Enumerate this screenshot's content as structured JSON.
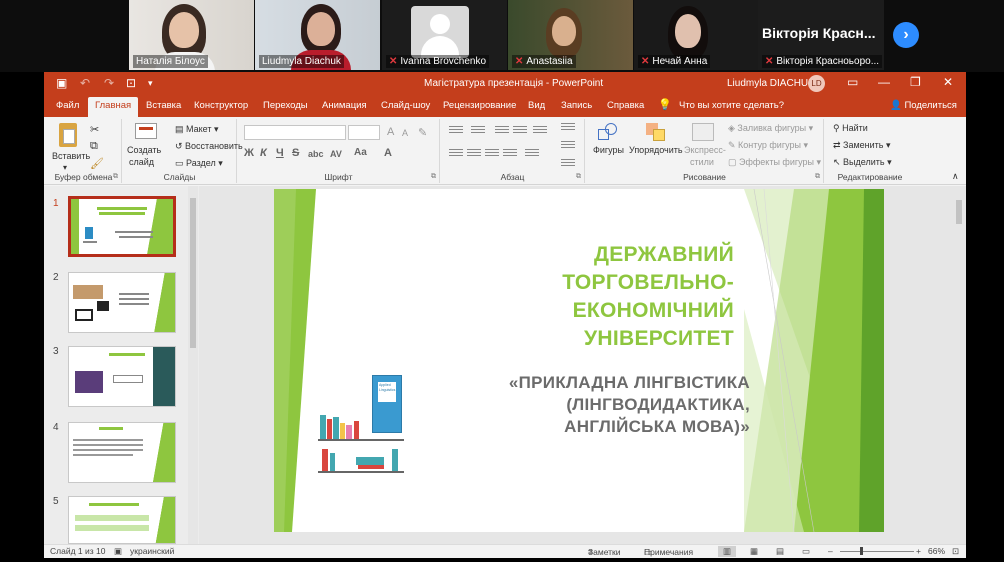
{
  "meeting": {
    "participants": [
      {
        "name": "Наталія Білоус",
        "muted": false,
        "active": false
      },
      {
        "name": "Liudmyla Diachuk",
        "muted": false,
        "active": true
      },
      {
        "name": "Ivanna Brovchenko",
        "muted": true,
        "active": false
      },
      {
        "name": "Anastasiia",
        "muted": true,
        "active": false
      },
      {
        "name": "Нечай Анна",
        "muted": true,
        "active": false
      },
      {
        "name": "Вікторія Красноьоро...",
        "muted": true,
        "active": false
      }
    ],
    "featured_name": "Вікторія Красн...",
    "next_icon": "chevron-right-icon",
    "active_color": "#23d959",
    "next_color": "#2d8cff"
  },
  "window": {
    "title": "Магістратура презентація  -  PowerPoint",
    "user": "Liudmyla DIACHUK",
    "user_initials": "LD",
    "brand_color": "#c43e1c"
  },
  "tabs": [
    "Файл",
    "Главная",
    "Вставка",
    "Конструктор",
    "Переходы",
    "Анимация",
    "Слайд-шоу",
    "Рецензирование",
    "Вид",
    "Запись",
    "Справка"
  ],
  "active_tab": "Главная",
  "tell_me": "Что вы хотите сделать?",
  "share": "Поделиться",
  "ribbon": {
    "clipboard": {
      "paste": "Вставить",
      "label": "Буфер обмена"
    },
    "slides": {
      "new_slide_1": "Создать",
      "new_slide_2": "слайд",
      "layout": "Макет",
      "reset": "Восстановить",
      "section": "Раздел",
      "label": "Слайды"
    },
    "font": {
      "bold": "Ж",
      "italic": "К",
      "underline": "Ч",
      "strike": "S",
      "spacing": "abc",
      "case": "AV",
      "grow": "A",
      "shrink": "A",
      "color": "A",
      "label": "Шрифт"
    },
    "paragraph": {
      "label": "Абзац"
    },
    "drawing": {
      "shapes": "Фигуры",
      "arrange": "Упорядочить",
      "quick_styles_1": "Экспресс-",
      "quick_styles_2": "стили",
      "fill": "Заливка фигуры",
      "outline": "Контур фигуры",
      "effects": "Эффекты фигуры",
      "label": "Рисование"
    },
    "editing": {
      "find": "Найти",
      "replace": "Заменить",
      "select": "Выделить",
      "label": "Редактирование"
    }
  },
  "thumbnails": [
    "1",
    "2",
    "3",
    "4",
    "5"
  ],
  "selected_slide": "1",
  "slide": {
    "title_line1": "ДЕРЖАВНИЙ ТОРГОВЕЛЬНО-",
    "title_line2": "ЕКОНОМІЧНИЙ УНІВЕРСИТЕТ",
    "sub_line1": "«ПРИКЛАДНА ЛІНГВІСТИКА",
    "sub_line2": "(ЛІНГВОДИДАКТИКА,",
    "sub_line3": "АНГЛІЙСЬКА МОВА)»",
    "book_label": "Applied Linguistics",
    "accent": "#8ec63f"
  },
  "status": {
    "slide_info": "Слайд 1 из 10",
    "language": "украинский",
    "notes": "Заметки",
    "comments": "Примечания",
    "zoom": "66%"
  }
}
